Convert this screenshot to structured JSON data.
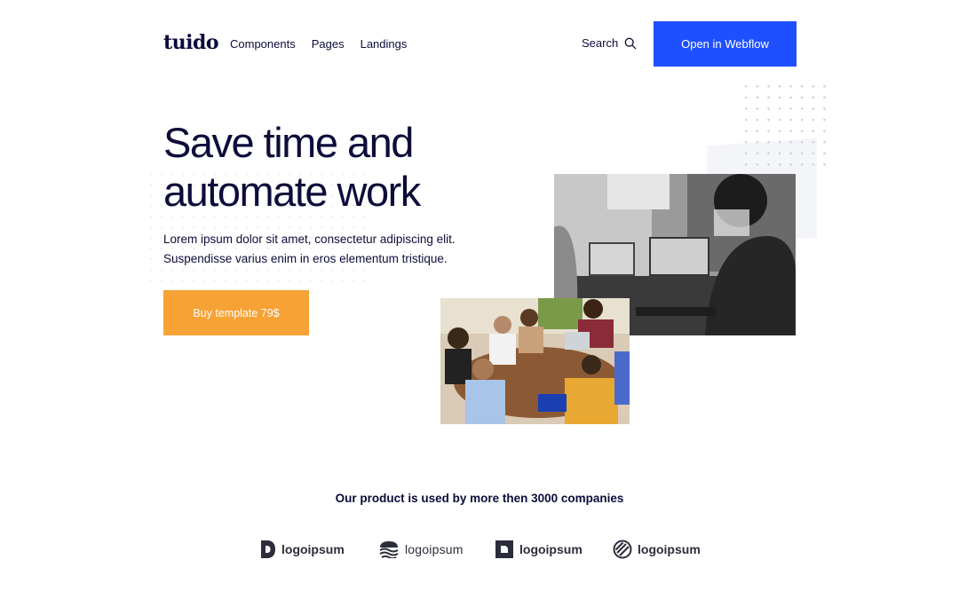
{
  "header": {
    "brand": "tuido",
    "nav": [
      {
        "label": "Components"
      },
      {
        "label": "Pages"
      },
      {
        "label": "Landings"
      }
    ],
    "search_label": "Search",
    "cta_label": "Open in Webflow"
  },
  "hero": {
    "headline_line1": "Save time and",
    "headline_line2": "automate work",
    "lead_line1": "Lorem ipsum dolor sit amet, consectetur adipiscing elit.",
    "lead_line2": "Suspendisse varius enim in eros elementum tristique.",
    "buy_label": "Buy template 79$"
  },
  "trust": {
    "heading": "Our product is used by more then 3000 companies",
    "logos": [
      {
        "name": "logoipsum",
        "icon": "d-shape-icon"
      },
      {
        "name": "logoipsum",
        "icon": "waves-icon"
      },
      {
        "name": "logoipsum",
        "icon": "square-cutout-icon"
      },
      {
        "name": "logoipsum",
        "icon": "circle-slash-icon"
      }
    ]
  },
  "colors": {
    "primary": "#1e50ff",
    "accent": "#f7a235",
    "text": "#0d0c3a"
  }
}
